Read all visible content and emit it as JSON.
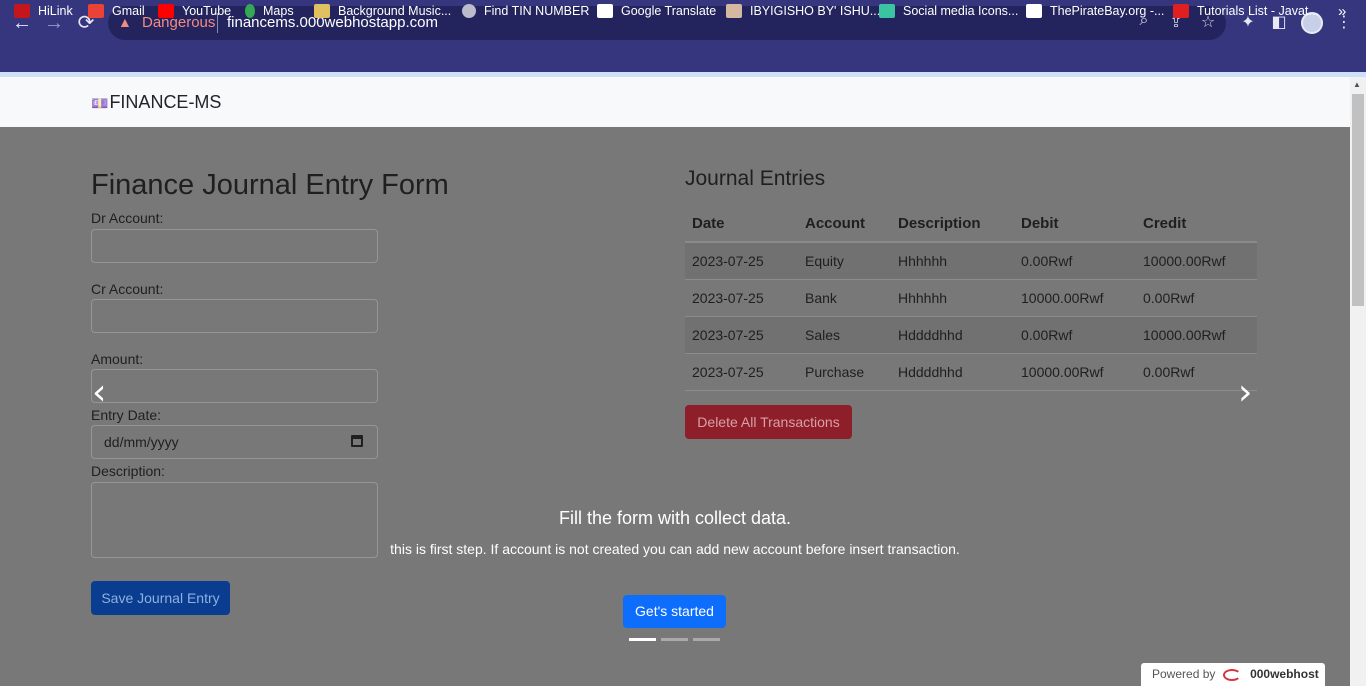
{
  "browser": {
    "security_label": "Dangerous",
    "url": "financems.000webhostapp.com",
    "bookmarks": [
      {
        "label": "HiLink",
        "color": "#c4161c"
      },
      {
        "label": "Gmail",
        "color": "#ea4335"
      },
      {
        "label": "YouTube",
        "color": "#ff0000"
      },
      {
        "label": "Maps",
        "color": "#34a853"
      },
      {
        "label": "Background Music...",
        "color": "#e0c060"
      },
      {
        "label": "Find TIN NUMBER",
        "color": "#bbbbcc"
      },
      {
        "label": "Google Translate",
        "color": "#ffffff"
      },
      {
        "label": "IBYIGISHO BY' ISHU...",
        "color": "#d4b8a0"
      },
      {
        "label": "Social media Icons...",
        "color": "#3ac4a0"
      },
      {
        "label": "ThePirateBay.org -...",
        "color": "#ffffff"
      },
      {
        "label": "Tutorials List - Javat...",
        "color": "#e02020"
      }
    ],
    "more_bookmarks": "»"
  },
  "navbar": {
    "brand": "FINANCE-MS"
  },
  "form": {
    "title": "Finance Journal Entry Form",
    "dr_label": "Dr Account:",
    "cr_label": "Cr Account:",
    "amount_label": "Amount:",
    "date_label": "Entry Date:",
    "date_placeholder": "dd/mm/yyyy",
    "description_label": "Description:",
    "save_label": "Save Journal Entry"
  },
  "entries": {
    "title": "Journal Entries",
    "headers": [
      "Date",
      "Account",
      "Description",
      "Debit",
      "Credit"
    ],
    "rows": [
      [
        "2023-07-25",
        "Equity",
        "Hhhhhh",
        "0.00Rwf",
        "10000.00Rwf"
      ],
      [
        "2023-07-25",
        "Bank",
        "Hhhhhh",
        "10000.00Rwf",
        "0.00Rwf"
      ],
      [
        "2023-07-25",
        "Sales",
        "Hddddhhd",
        "0.00Rwf",
        "10000.00Rwf"
      ],
      [
        "2023-07-25",
        "Purchase",
        "Hddddhhd",
        "10000.00Rwf",
        "0.00Rwf"
      ]
    ],
    "delete_label": "Delete All Transactions"
  },
  "carousel": {
    "caption_title": "Fill the form with collect data.",
    "caption_text": "this is first step. If account is not created you can add new account before insert transaction.",
    "cta_label": "Get's started",
    "prev_glyph": "‹",
    "next_glyph": "›",
    "slide_count": 3,
    "active_slide": 1
  },
  "footer_badge": {
    "prefix": "Powered by",
    "brand": "000webhost"
  }
}
